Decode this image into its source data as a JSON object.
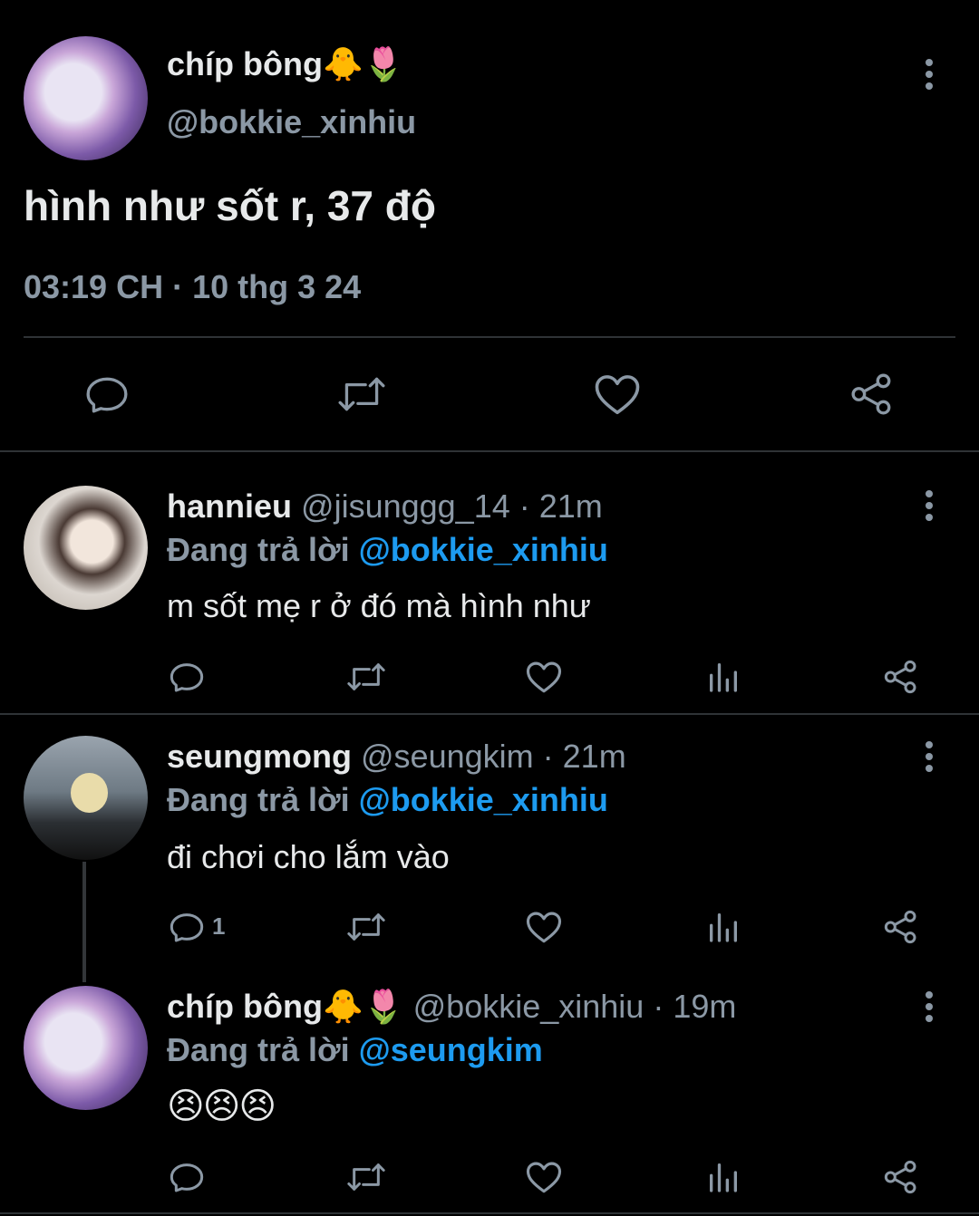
{
  "main_tweet": {
    "display_name": "chíp bông🐥🌷",
    "handle": "@bokkie_xinhiu",
    "text": "hình như sốt r, 37 độ",
    "timestamp": "03:19 CH · 10 thg 3 24"
  },
  "replies": [
    {
      "display_name": "hannieu",
      "handle": "@jisunggg_14",
      "time": "· 21m",
      "replying_label": "Đang trả lời",
      "replying_to": "@bokkie_xinhiu",
      "text": "m sốt mẹ r ở đó mà hình như",
      "reply_count": ""
    },
    {
      "display_name": "seungmong",
      "handle": "@seungkim",
      "time": "· 21m",
      "replying_label": "Đang trả lời",
      "replying_to": "@bokkie_xinhiu",
      "text": "đi chơi cho lắm vào",
      "reply_count": "1"
    },
    {
      "display_name": "chíp bông🐥🌷",
      "handle": "@bokkie_xinhiu",
      "time": "· 19m",
      "replying_label": "Đang trả lời",
      "replying_to": "@seungkim",
      "text": "😣😣😣",
      "reply_count": ""
    }
  ],
  "icons": {
    "reply": "reply-icon",
    "retweet": "retweet-icon",
    "like": "heart-icon",
    "views": "views-icon",
    "share": "share-icon",
    "more": "more-icon"
  },
  "colors": {
    "background": "#000000",
    "text": "#e7e9ea",
    "muted": "#8b98a5",
    "link": "#1d9bf0",
    "divider": "#2f3336"
  }
}
